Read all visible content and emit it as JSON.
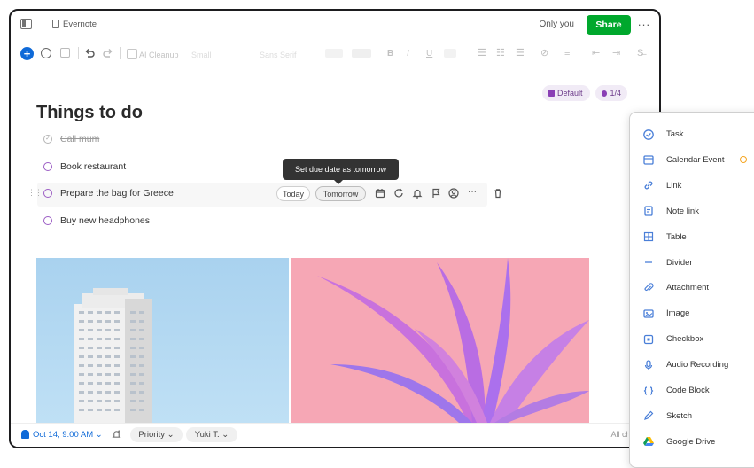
{
  "header": {
    "notebook": "Evernote",
    "visibility": "Only you",
    "share_label": "Share",
    "more": "···"
  },
  "toolbar": {
    "ai_cleanup": "AI Cleanup",
    "font_style": "Sans Serif",
    "font_size": "Small"
  },
  "tags": {
    "default": "Default",
    "progress": "1/4"
  },
  "note": {
    "title": "Things to do",
    "tasks": [
      {
        "label": "Call mum",
        "done": true
      },
      {
        "label": "Book restaurant",
        "done": false
      },
      {
        "label": "Prepare the bag for Greece",
        "done": false
      },
      {
        "label": "Buy new headphones",
        "done": false
      }
    ]
  },
  "task_toolbar": {
    "today": "Today",
    "tomorrow": "Tomorrow",
    "tooltip": "Set due date as tomorrow",
    "more": "···"
  },
  "bottom": {
    "reminder": "Oct 14, 9:00 AM",
    "priority": "Priority",
    "assignee": "Yuki T.",
    "status": "All changes"
  },
  "insert_menu": [
    {
      "label": "Task",
      "icon": "task-icon"
    },
    {
      "label": "Calendar Event",
      "icon": "calendar-icon",
      "premium": true
    },
    {
      "label": "Link",
      "icon": "link-icon"
    },
    {
      "label": "Note link",
      "icon": "note-link-icon"
    },
    {
      "label": "Table",
      "icon": "table-icon"
    },
    {
      "label": "Divider",
      "icon": "divider-icon"
    },
    {
      "label": "Attachment",
      "icon": "paperclip-icon"
    },
    {
      "label": "Image",
      "icon": "image-icon"
    },
    {
      "label": "Checkbox",
      "icon": "checkbox-icon"
    },
    {
      "label": "Audio Recording",
      "icon": "microphone-icon"
    },
    {
      "label": "Code Block",
      "icon": "code-block-icon"
    },
    {
      "label": "Sketch",
      "icon": "sketch-icon"
    },
    {
      "label": "Google Drive",
      "icon": "google-drive-icon"
    }
  ],
  "colors": {
    "accent": "#0f6ad8",
    "share": "#00a82d",
    "task_purple": "#9b5cc4",
    "tag_bg": "#f1ebf6"
  }
}
